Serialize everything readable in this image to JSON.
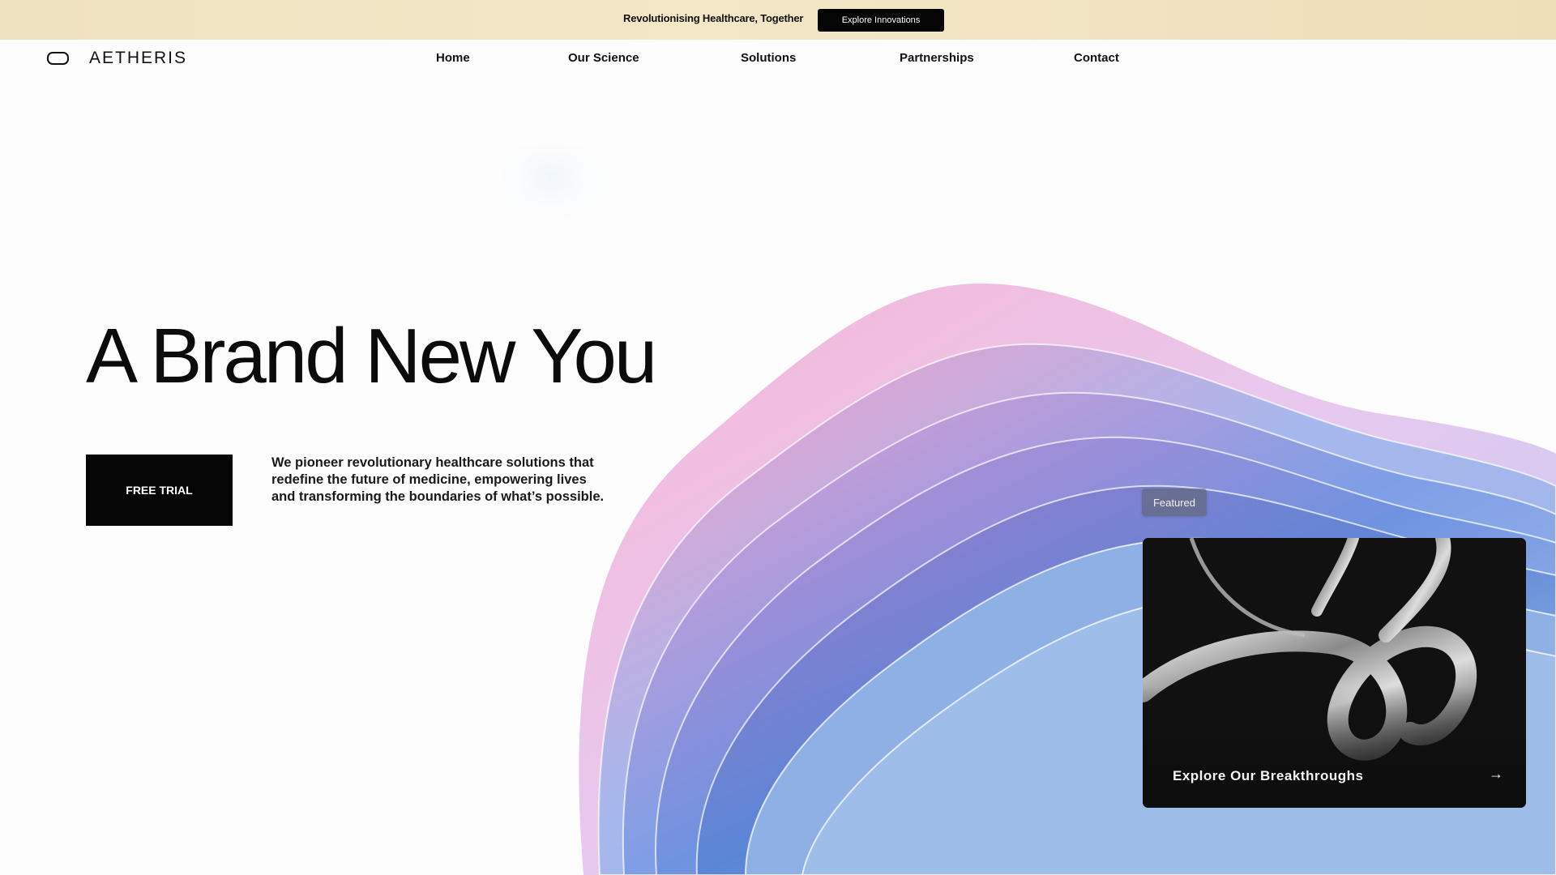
{
  "announcement": {
    "text": "Revolutionising Healthcare, Together",
    "button_label": "Explore Innovations"
  },
  "brand": {
    "name": "AETHERIS",
    "logo_icon": "pill-outline-icon"
  },
  "nav": {
    "items": [
      {
        "label": "Home"
      },
      {
        "label": "Our Science"
      },
      {
        "label": "Solutions"
      },
      {
        "label": "Partnerships"
      },
      {
        "label": "Contact"
      }
    ]
  },
  "hero": {
    "headline": "A Brand New You",
    "cta_label": "FREE TRIAL",
    "description": "We pioneer revolutionary healthcare solutions that redefine the future of medicine, empowering lives and transforming the boundaries of what’s possible."
  },
  "featured": {
    "badge": "Featured",
    "card_title": "Explore Our Breakthroughs",
    "arrow_icon": "arrow-right-icon"
  },
  "colors": {
    "announcement_bg": "#efe2c0",
    "primary_button": "#050505",
    "art_pink": "#f4a3c8",
    "art_blue": "#7fa6e6",
    "art_lavender": "#c9b8f0"
  }
}
